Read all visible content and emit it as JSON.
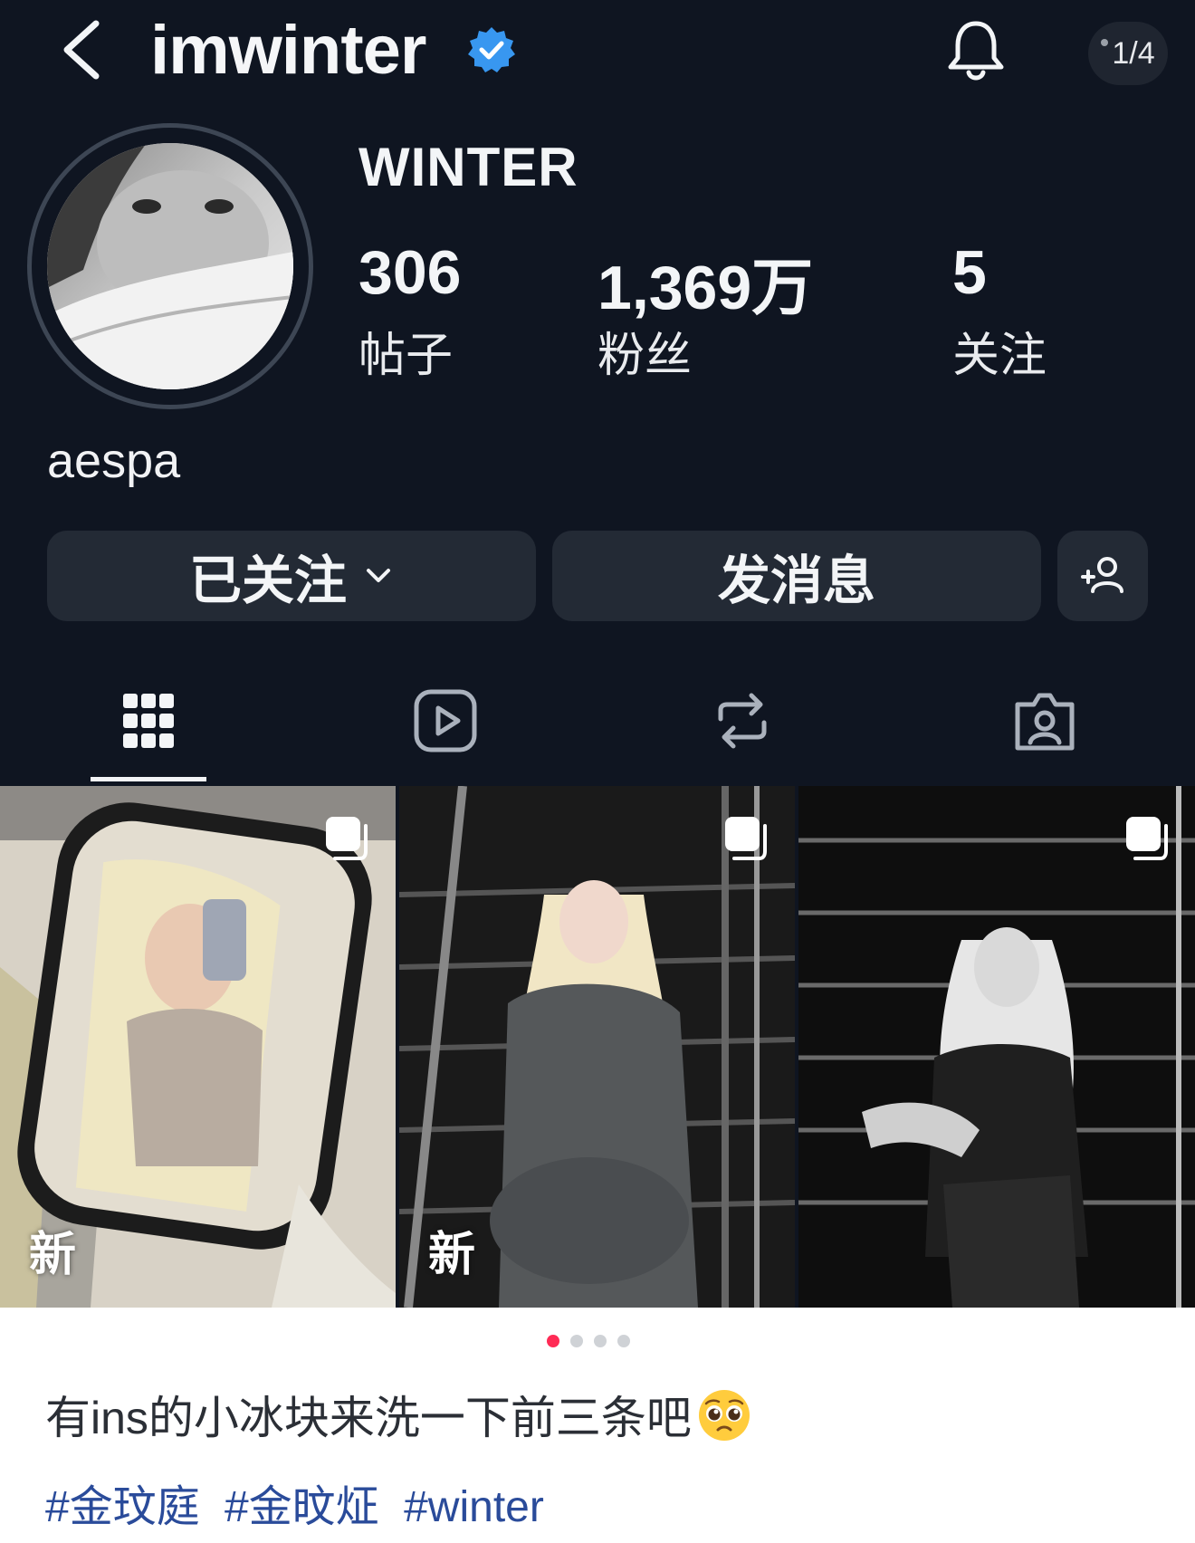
{
  "header": {
    "username": "imwinter",
    "pager": "1/4"
  },
  "profile": {
    "display_name": "WINTER",
    "stats": [
      {
        "value": "306",
        "label": "帖子"
      },
      {
        "value": "1,369万",
        "label": "粉丝"
      },
      {
        "value": "5",
        "label": "关注"
      }
    ],
    "bio": "aespa"
  },
  "buttons": {
    "following": "已关注",
    "message": "发消息"
  },
  "tabs": [
    "posts-grid-icon",
    "reels-icon",
    "reposts-icon",
    "tagged-icon"
  ],
  "posts": [
    {
      "badge": "新",
      "multi": true
    },
    {
      "badge": "新",
      "multi": true
    },
    {
      "badge": "",
      "multi": true
    }
  ],
  "carousel": {
    "total": 4,
    "active": 1
  },
  "caption": {
    "text": "有ins的小冰块来洗一下前三条吧",
    "emoji": "pleading-face-emoji"
  },
  "hashtags": [
    "#金玟庭",
    "#金旼炡",
    "#winter"
  ],
  "colors": {
    "background": "#0f1521",
    "button": "#232a35",
    "verified": "#3897f0",
    "hashtag": "#2a4b9a",
    "active_dot": "#ff2b55"
  }
}
